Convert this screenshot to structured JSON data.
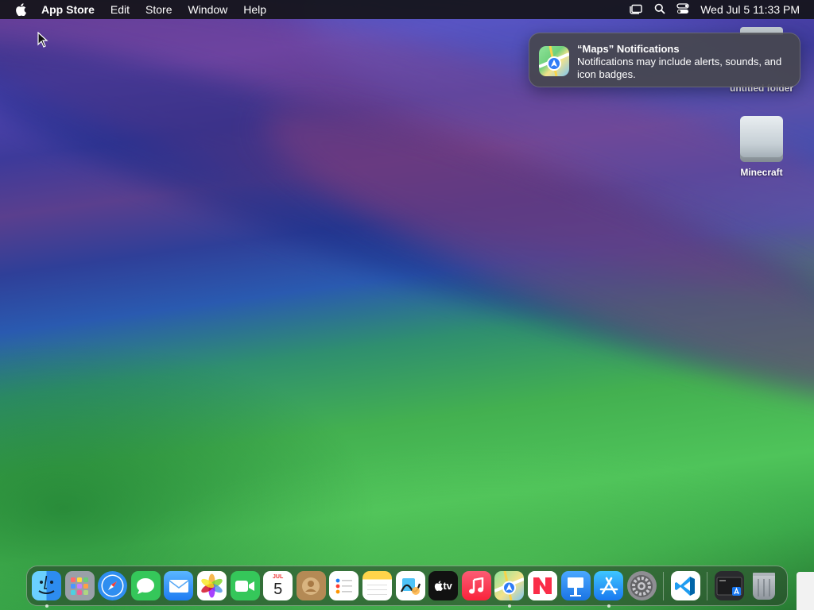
{
  "menubar": {
    "app_name": "App Store",
    "items": [
      "Edit",
      "Store",
      "Window",
      "Help"
    ],
    "clock": "Wed Jul 5  11:33 PM",
    "status_icons": [
      "stage-manager-icon",
      "spotlight-icon",
      "control-center-icon"
    ]
  },
  "notification": {
    "title": "“Maps” Notifications",
    "body": "Notifications may include alerts, sounds, and icon badges.",
    "icon": "maps-icon"
  },
  "desktop": {
    "icons": [
      {
        "label": "untitled folder",
        "icon": "folder-icon"
      },
      {
        "label": "Minecraft",
        "icon": "drive-icon"
      }
    ]
  },
  "dock": {
    "items": [
      {
        "name": "Finder",
        "icon": "finder-icon",
        "running": true
      },
      {
        "name": "Launchpad",
        "icon": "launchpad-icon",
        "running": false
      },
      {
        "name": "Safari",
        "icon": "safari-icon",
        "running": false
      },
      {
        "name": "Messages",
        "icon": "messages-icon",
        "running": false
      },
      {
        "name": "Mail",
        "icon": "mail-icon",
        "running": false
      },
      {
        "name": "Photos",
        "icon": "photos-icon",
        "running": false
      },
      {
        "name": "FaceTime",
        "icon": "facetime-icon",
        "running": false
      },
      {
        "name": "Calendar",
        "icon": "calendar-icon",
        "running": false,
        "month": "JUL",
        "day": "5"
      },
      {
        "name": "Contacts",
        "icon": "contacts-icon",
        "running": false
      },
      {
        "name": "Reminders",
        "icon": "reminders-icon",
        "running": false
      },
      {
        "name": "Notes",
        "icon": "notes-icon",
        "running": false
      },
      {
        "name": "Freeform",
        "icon": "freeform-icon",
        "running": false
      },
      {
        "name": "TV",
        "icon": "tv-icon",
        "running": false,
        "glyph": "tv"
      },
      {
        "name": "Music",
        "icon": "music-icon",
        "running": false
      },
      {
        "name": "Maps",
        "icon": "maps-icon",
        "running": true
      },
      {
        "name": "News",
        "icon": "news-icon",
        "running": false
      },
      {
        "name": "Keynote",
        "icon": "keynote-icon",
        "running": false
      },
      {
        "name": "App Store",
        "icon": "app-store-icon",
        "running": true
      },
      {
        "name": "System Settings",
        "icon": "settings-icon",
        "running": false
      },
      {
        "name": "Visual Studio Code",
        "icon": "vscode-icon",
        "running": false
      },
      {
        "name": "Screenshot",
        "icon": "screenshot-icon",
        "running": false
      },
      {
        "name": "Trash",
        "icon": "trash-icon",
        "running": false
      }
    ]
  }
}
